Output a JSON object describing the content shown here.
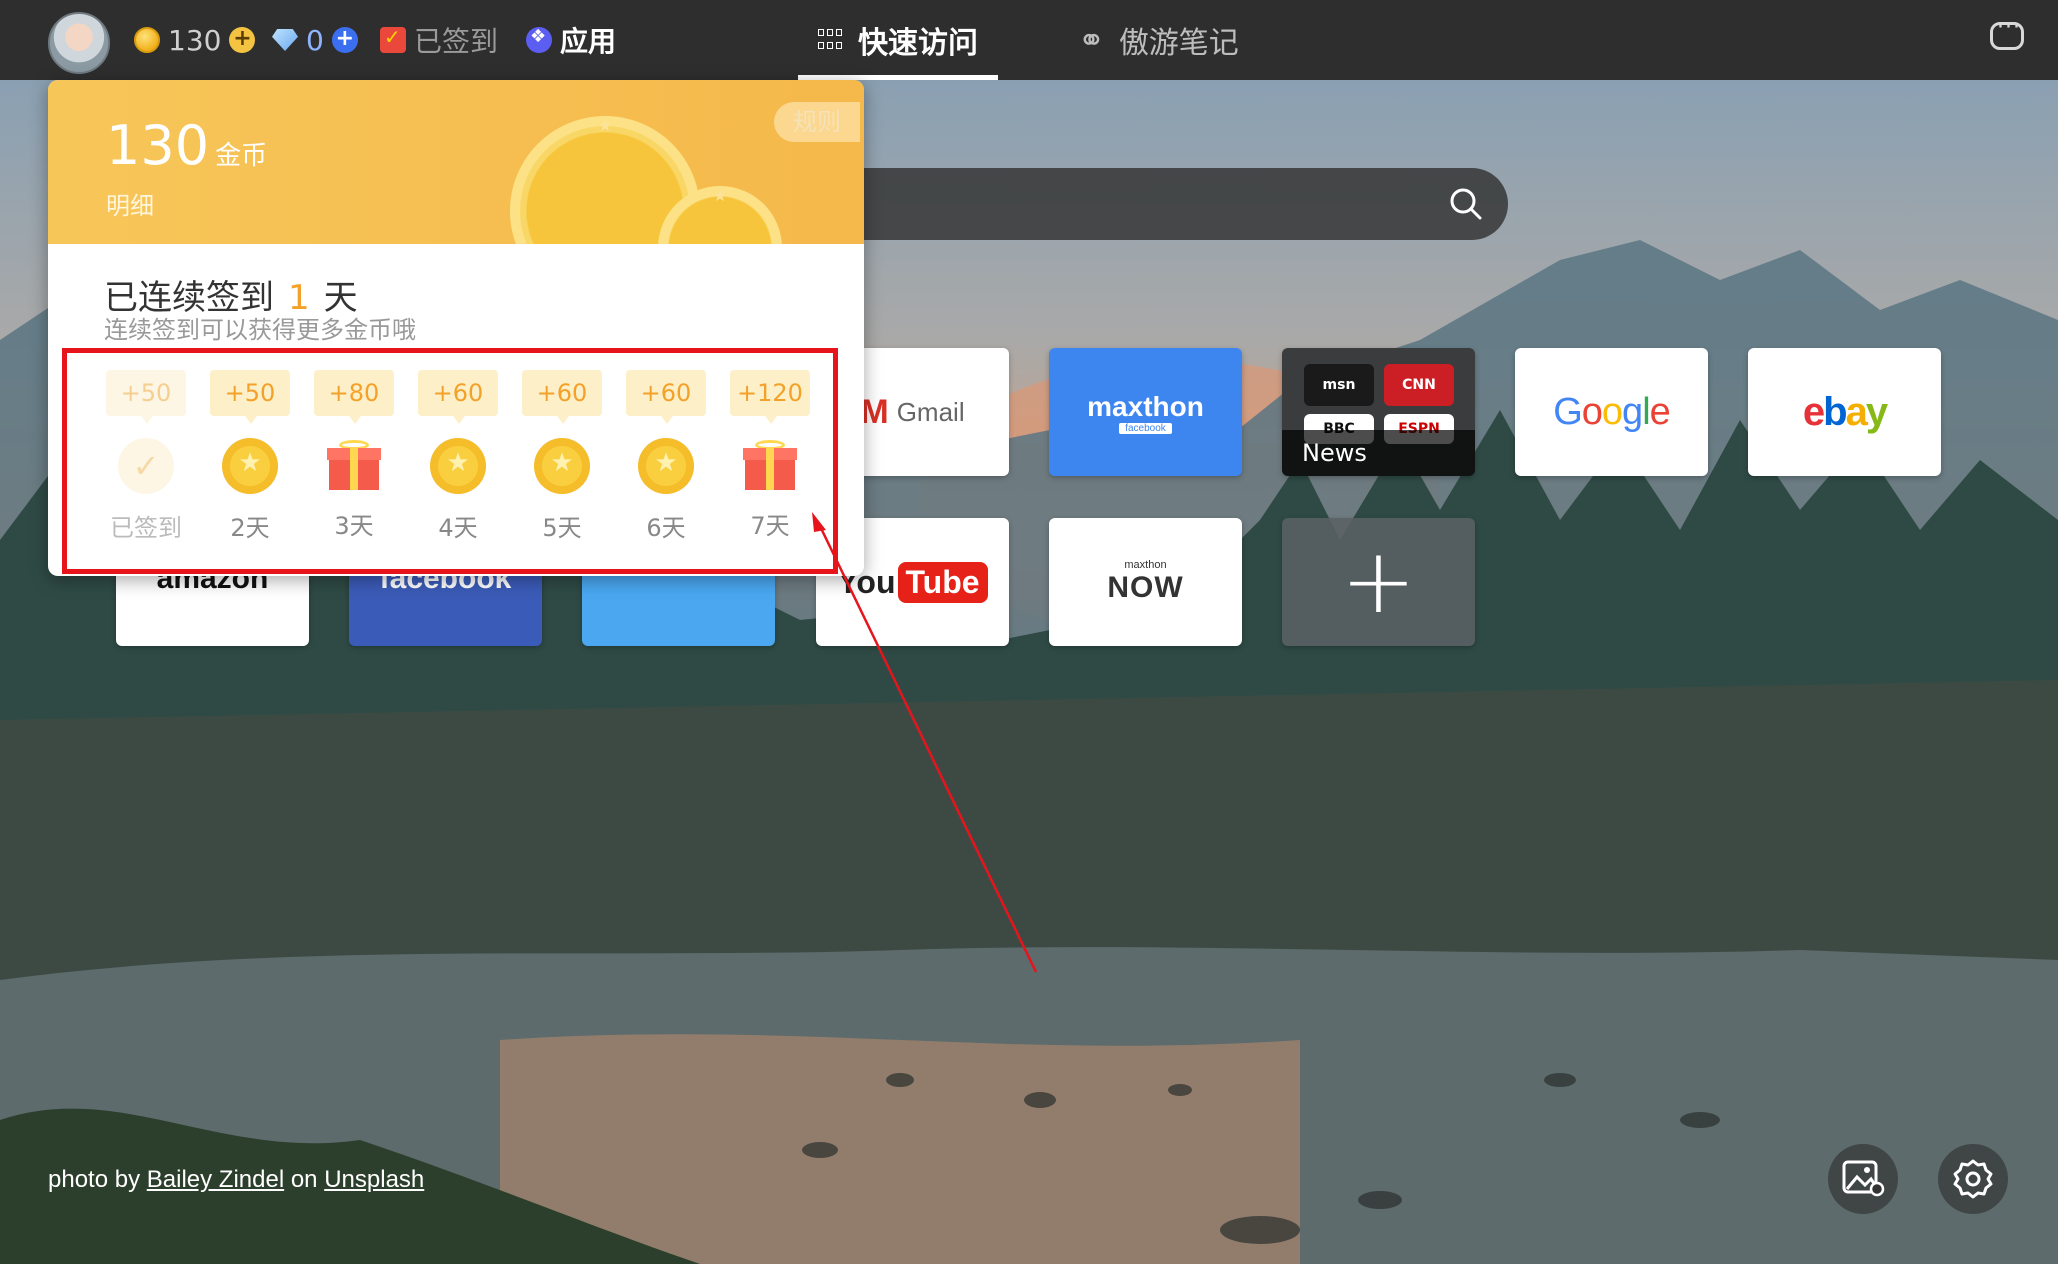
{
  "topbar": {
    "coins": "130",
    "diamonds": "0",
    "checked_in": "已签到",
    "apps": "应用",
    "tabs": [
      {
        "label": "快速访问",
        "active": true
      },
      {
        "label": "傲游笔记",
        "active": false
      }
    ]
  },
  "search": {
    "placeholder": ""
  },
  "tiles": {
    "gmail": "Gmail",
    "maxthon": "maxthon",
    "maxthon_sub": "facebook",
    "news_label": "News",
    "news_sources": [
      "msn",
      "CNN",
      "BBC",
      "ESPN"
    ],
    "google": "Google",
    "ebay": "ebay",
    "amazon": "amazon",
    "facebook": "facebook",
    "youtube_you": "You",
    "youtube_tube": "Tube",
    "now_small": "maxthon",
    "now_big": "NOW",
    "add": "+"
  },
  "popup": {
    "amount": "130",
    "unit": "金币",
    "detail": "明细",
    "rules": "规则",
    "streak_prefix": "已连续签到",
    "streak_days": "1",
    "streak_suffix": "天",
    "streak_sub": "连续签到可以获得更多金币哦",
    "days": [
      {
        "bonus": "+50",
        "label": "已签到",
        "kind": "done"
      },
      {
        "bonus": "+50",
        "label": "2天",
        "kind": "coin"
      },
      {
        "bonus": "+80",
        "label": "3天",
        "kind": "gift"
      },
      {
        "bonus": "+60",
        "label": "4天",
        "kind": "coin"
      },
      {
        "bonus": "+60",
        "label": "5天",
        "kind": "coin"
      },
      {
        "bonus": "+60",
        "label": "6天",
        "kind": "coin"
      },
      {
        "bonus": "+120",
        "label": "7天",
        "kind": "gift"
      }
    ]
  },
  "credit": {
    "prefix": "photo by",
    "author": "Bailey Zindel",
    "mid": "on",
    "site": "Unsplash"
  },
  "colors": {
    "topbar": "#2e2e2e",
    "popup_header": "#f7c659",
    "accent_orange": "#f4a12a",
    "highlight_red": "#e8141c",
    "maxthon_blue": "#3d86f0"
  },
  "icons": [
    "avatar",
    "coin-icon",
    "plus-icon",
    "diamond-icon",
    "gift-check-icon",
    "apps-icon",
    "grid-icon",
    "notes-icon",
    "chat-icon",
    "search-icon",
    "wallpaper-icon",
    "settings-icon"
  ]
}
